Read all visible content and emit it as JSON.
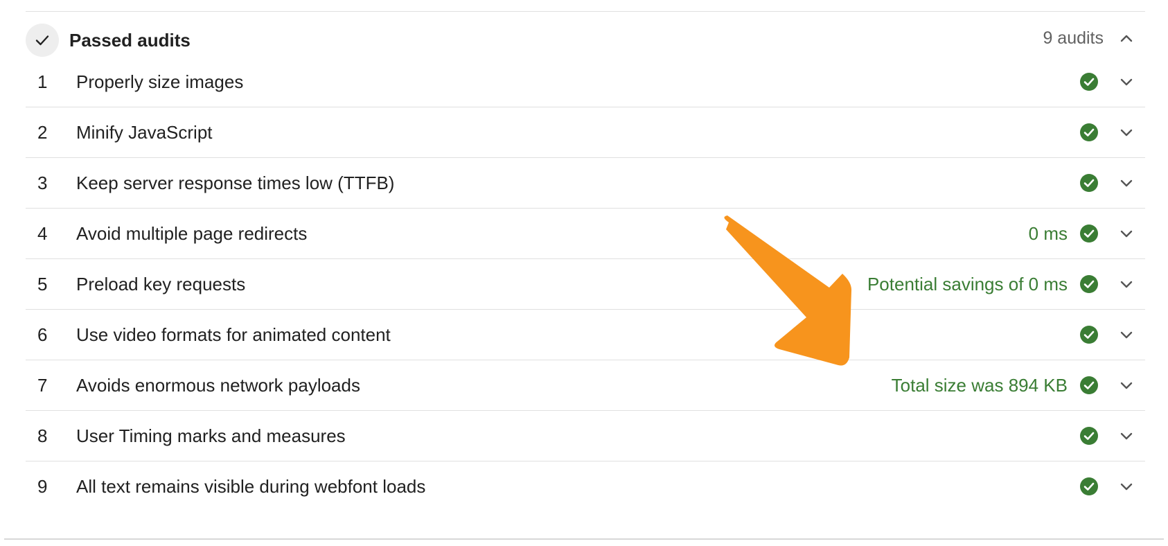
{
  "group": {
    "title": "Passed audits",
    "count": "9 audits",
    "status_icon": "checkmark-icon",
    "toggle_icon": "chevron-up-icon"
  },
  "audits": [
    {
      "index": "1",
      "title": "Properly size images",
      "display": ""
    },
    {
      "index": "2",
      "title": "Minify JavaScript",
      "display": ""
    },
    {
      "index": "3",
      "title": "Keep server response times low (TTFB)",
      "display": ""
    },
    {
      "index": "4",
      "title": "Avoid multiple page redirects",
      "display": "0 ms"
    },
    {
      "index": "5",
      "title": "Preload key requests",
      "display": "Potential savings of 0 ms"
    },
    {
      "index": "6",
      "title": "Use video formats for animated content",
      "display": ""
    },
    {
      "index": "7",
      "title": "Avoids enormous network payloads",
      "display": "Total size was 894 KB"
    },
    {
      "index": "8",
      "title": "User Timing marks and measures",
      "display": ""
    },
    {
      "index": "9",
      "title": "All text remains visible during webfont loads",
      "display": ""
    }
  ],
  "colors": {
    "pass_green": "#3a7d34",
    "annotation_orange": "#f7941d",
    "divider": "#e0e0e0"
  },
  "icons": {
    "pass": "pass-check-circle-icon",
    "expand": "chevron-down-icon"
  }
}
